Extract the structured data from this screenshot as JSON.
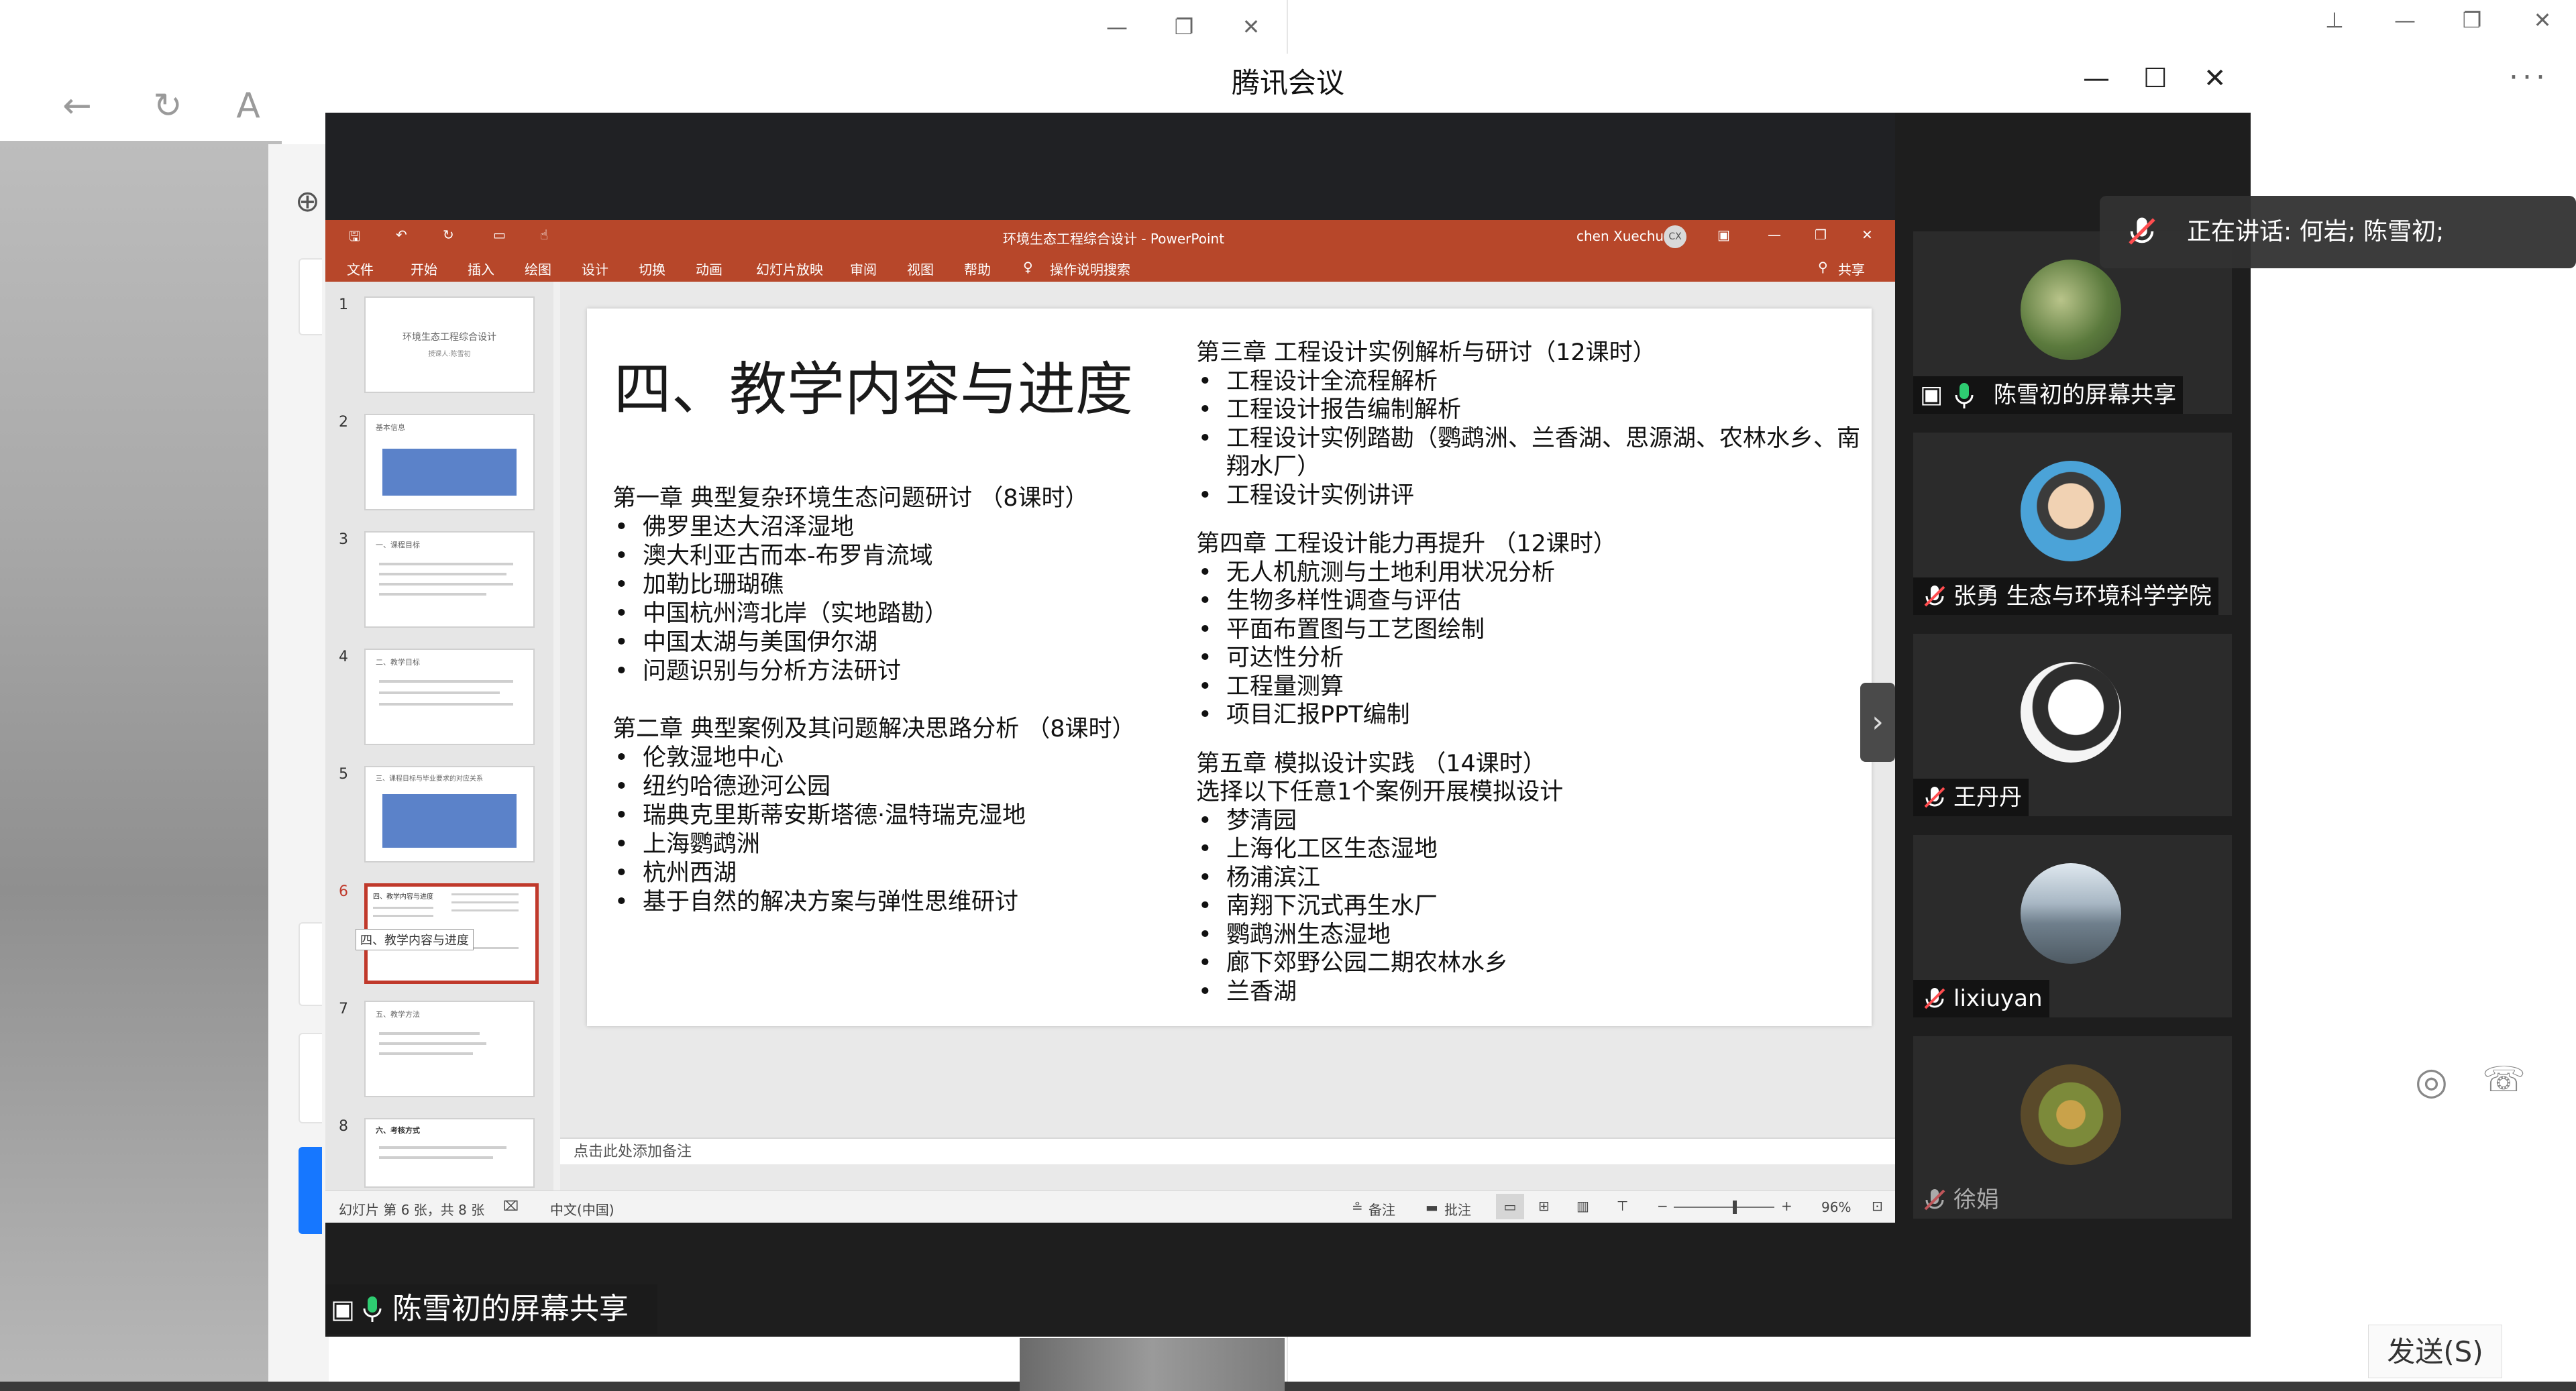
{
  "meeting": {
    "title": "腾讯会议",
    "share_label": "陈雪初的屏幕共享",
    "speaking": "正在讲话: 何岩; 陈雪初;"
  },
  "participants": [
    {
      "name": "陈雪初的屏幕共享",
      "mic": "on",
      "avatar": "landscape-avatar"
    },
    {
      "name": "张勇 生态与环境科学学院",
      "mic": "muted",
      "avatar": "cartoon-boy-avatar"
    },
    {
      "name": "王丹丹",
      "mic": "muted",
      "avatar": "anime-girl-avatar"
    },
    {
      "name": "lixiuyan",
      "mic": "muted",
      "avatar": "city-avatar"
    },
    {
      "name": "徐娟",
      "mic": "muted",
      "avatar": "flower-avatar"
    }
  ],
  "powerpoint": {
    "window_title": "环境生态工程综合设计 - PowerPoint",
    "user": "chen Xuechu",
    "user_initials": "CX",
    "share_button": "共享",
    "ribbon_tabs": [
      "文件",
      "开始",
      "插入",
      "绘图",
      "设计",
      "切换",
      "动画",
      "幻灯片放映",
      "审阅",
      "视图",
      "帮助",
      "操作说明搜索"
    ],
    "thumbnails": [
      {
        "num": "1",
        "title": "环境生态工程综合设计",
        "subtitle": "授课人:陈雪初"
      },
      {
        "num": "2",
        "title": "基本信息"
      },
      {
        "num": "3",
        "title": "一、课程目标"
      },
      {
        "num": "4",
        "title": "二、教学目标"
      },
      {
        "num": "5",
        "title": "三、课程目标与毕业要求的对应关系"
      },
      {
        "num": "6",
        "title": "四、教学内容与进度"
      },
      {
        "num": "7",
        "title": "五、教学方法"
      },
      {
        "num": "8",
        "title": "六、考核方式"
      }
    ],
    "tooltip": "四、教学内容与进度",
    "notes_placeholder": "点击此处添加备注",
    "status": {
      "slide_count": "幻灯片 第 6 张，共 8 张",
      "language": "中文(中国)",
      "notes_btn": "备注",
      "comments_btn": "批注",
      "zoom": "96%"
    }
  },
  "slide": {
    "title": "四、教学内容与进度",
    "left": [
      {
        "heading": "第一章 典型复杂环境生态问题研讨 （8课时）",
        "items": [
          "佛罗里达大沼泽湿地",
          "澳大利亚古而本-布罗肯流域",
          "加勒比珊瑚礁",
          "中国杭州湾北岸（实地踏勘）",
          "中国太湖与美国伊尔湖",
          "问题识别与分析方法研讨"
        ]
      },
      {
        "heading": "第二章 典型案例及其问题解决思路分析 （8课时）",
        "items": [
          "伦敦湿地中心",
          "纽约哈德逊河公园",
          "瑞典克里斯蒂安斯塔德·温特瑞克湿地",
          "上海鹦鹉洲",
          "杭州西湖",
          "基于自然的解决方案与弹性思维研讨"
        ]
      }
    ],
    "right": [
      {
        "heading": "第三章 工程设计实例解析与研讨（12课时）",
        "items": [
          "工程设计全流程解析",
          "工程设计报告编制解析",
          "工程设计实例踏勘（鹦鹉洲、兰香湖、思源湖、农林水乡、南翔水厂）",
          "工程设计实例讲评"
        ]
      },
      {
        "heading": "第四章 工程设计能力再提升 （12课时）",
        "items": [
          "无人机航测与土地利用状况分析",
          "生物多样性调查与评估",
          "平面布置图与工艺图绘制",
          "可达性分析",
          "工程量测算",
          "项目汇报PPT编制"
        ]
      },
      {
        "heading": "第五章 模拟设计实践 （14课时）",
        "subheading": "选择以下任意1个案例开展模拟设计",
        "items": [
          "梦清园",
          "上海化工区生态湿地",
          "杨浦滨江",
          "南翔下沉式再生水厂",
          "鹦鹉洲生态湿地",
          "廊下郊野公园二期农林水乡",
          "兰香湖"
        ]
      }
    ]
  },
  "background": {
    "send_button": "发送(S)",
    "font_button": "A"
  },
  "colors": {
    "ppt_red": "#b7472a",
    "meeting_dark": "#1e1e1e",
    "mic_green": "#2ecc71",
    "mic_muted": "#ff4d4f"
  }
}
